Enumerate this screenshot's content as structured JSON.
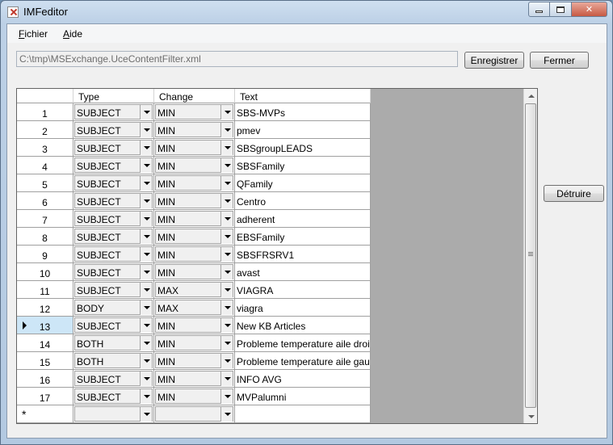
{
  "window": {
    "title": "IMFeditor"
  },
  "menu": [
    {
      "accel": "F",
      "rest": "ichier"
    },
    {
      "accel": "A",
      "rest": "ide"
    }
  ],
  "toolbar": {
    "path": "C:\\tmp\\MSExchange.UceContentFilter.xml",
    "save_label": "Enregistrer",
    "close_label": "Fermer"
  },
  "side": {
    "delete_label": "Détruire"
  },
  "grid": {
    "columns": [
      "Type",
      "Change",
      "Text"
    ],
    "selected_row": 13,
    "new_row_marker": "*",
    "rows": [
      {
        "num": "1",
        "type": "SUBJECT",
        "change": "MIN",
        "text": "SBS-MVPs"
      },
      {
        "num": "2",
        "type": "SUBJECT",
        "change": "MIN",
        "text": "pmev"
      },
      {
        "num": "3",
        "type": "SUBJECT",
        "change": "MIN",
        "text": "SBSgroupLEADS"
      },
      {
        "num": "4",
        "type": "SUBJECT",
        "change": "MIN",
        "text": "SBSFamily"
      },
      {
        "num": "5",
        "type": "SUBJECT",
        "change": "MIN",
        "text": "QFamily"
      },
      {
        "num": "6",
        "type": "SUBJECT",
        "change": "MIN",
        "text": "Centro"
      },
      {
        "num": "7",
        "type": "SUBJECT",
        "change": "MIN",
        "text": "adherent"
      },
      {
        "num": "8",
        "type": "SUBJECT",
        "change": "MIN",
        "text": "EBSFamily"
      },
      {
        "num": "9",
        "type": "SUBJECT",
        "change": "MIN",
        "text": "SBSFRSRV1"
      },
      {
        "num": "10",
        "type": "SUBJECT",
        "change": "MIN",
        "text": "avast"
      },
      {
        "num": "11",
        "type": "SUBJECT",
        "change": "MAX",
        "text": "VIAGRA"
      },
      {
        "num": "12",
        "type": "BODY",
        "change": "MAX",
        "text": "viagra"
      },
      {
        "num": "13",
        "type": "SUBJECT",
        "change": "MIN",
        "text": "New KB Articles"
      },
      {
        "num": "14",
        "type": "BOTH",
        "change": "MIN",
        "text": "Probleme temperature aile droite"
      },
      {
        "num": "15",
        "type": "BOTH",
        "change": "MIN",
        "text": "Probleme temperature aile gauche"
      },
      {
        "num": "16",
        "type": "SUBJECT",
        "change": "MIN",
        "text": "INFO AVG"
      },
      {
        "num": "17",
        "type": "SUBJECT",
        "change": "MIN",
        "text": "MVPalumni"
      }
    ]
  }
}
